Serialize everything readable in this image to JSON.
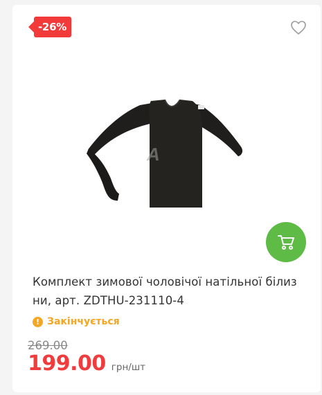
{
  "product": {
    "discount_badge": "-26%",
    "title": "Комплект зимової чоловічої натільної білиз ни, арт. ZDTHU-231110-4",
    "status": "Закінчується",
    "status_icon": "exclamation-icon",
    "old_price": "269.00",
    "price": "199.00",
    "unit": "грн/шт",
    "image_alt": "black long-sleeve thermal shirt",
    "wishlist_icon": "heart-outline-icon",
    "cart_icon": "cart-icon"
  },
  "colors": {
    "badge": "#f23a3a",
    "cart_button": "#5dbb46",
    "status": "#f5a623",
    "price": "#f03c3c"
  }
}
